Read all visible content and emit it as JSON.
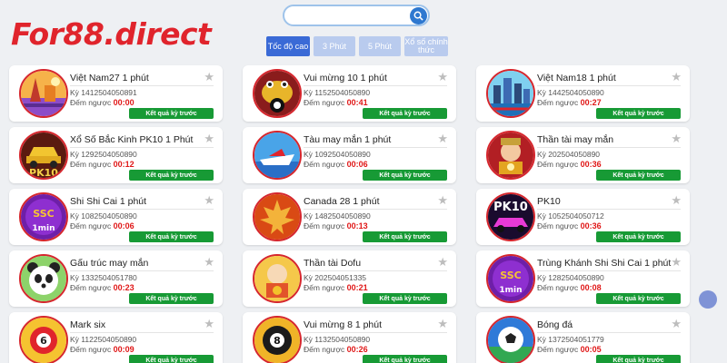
{
  "brand": {
    "logo": "For88.direct"
  },
  "search": {
    "placeholder": ""
  },
  "tabs": [
    {
      "label": "Tốc độ cao",
      "active": true
    },
    {
      "label": "3 Phút",
      "active": false
    },
    {
      "label": "5 Phút",
      "active": false
    },
    {
      "label": "Xổ số chính thức",
      "active": false
    }
  ],
  "labels": {
    "period_prefix": "Kỳ",
    "countdown_prefix": "Đếm ngược",
    "result_button": "Kết quả kỳ trước"
  },
  "games": [
    {
      "title": "Việt Nam27 1 phút",
      "period": "1412504050891",
      "countdown": "00:00",
      "icon": "vietnam-landmark-icon"
    },
    {
      "title": "Vui mừng 10 1 phút",
      "period": "1152504050890",
      "countdown": "00:41",
      "icon": "golden-frog-ball-icon"
    },
    {
      "title": "Việt Nam18 1 phút",
      "period": "1442504050890",
      "countdown": "00:27",
      "icon": "vietnam-city-icon"
    },
    {
      "title": "Xổ Số Bắc Kinh PK10 1 Phút",
      "period": "1292504050890",
      "countdown": "00:12",
      "icon": "pk10-car-icon"
    },
    {
      "title": "Tàu may mắn 1 phút",
      "period": "1092504050890",
      "countdown": "00:06",
      "icon": "speedboat-icon"
    },
    {
      "title": "Thần tài may mắn",
      "period": "202504050890",
      "countdown": "00:36",
      "icon": "wealth-god-icon"
    },
    {
      "title": "Shi Shi Cai 1 phút",
      "period": "1082504050890",
      "countdown": "00:06",
      "icon": "shishicai-1min-icon"
    },
    {
      "title": "Canada 28 1 phút",
      "period": "1482504050890",
      "countdown": "00:13",
      "icon": "maple-leaf-icon"
    },
    {
      "title": "PK10",
      "period": "1052504050712",
      "countdown": "00:36",
      "icon": "pk10-pink-car-icon"
    },
    {
      "title": "Gấu trúc may mắn",
      "period": "1332504051780",
      "countdown": "00:23",
      "icon": "panda-icon"
    },
    {
      "title": "Thần tài Dofu",
      "period": "202504051335",
      "countdown": "00:21",
      "icon": "dofu-god-icon"
    },
    {
      "title": "Trùng Khánh Shi Shi Cai 1 phút",
      "period": "1282504050890",
      "countdown": "00:08",
      "icon": "shishicai-1min-icon"
    },
    {
      "title": "Mark six",
      "period": "1122504050890",
      "countdown": "00:09",
      "icon": "lottery-ball-6-icon"
    },
    {
      "title": "Vui mừng 8 1 phút",
      "period": "1132504050890",
      "countdown": "00:26",
      "icon": "ball-8-icon"
    },
    {
      "title": "Bóng đá",
      "period": "1372504051779",
      "countdown": "00:05",
      "icon": "soccer-ball-icon"
    }
  ],
  "colors": {
    "brand_red": "#e0242c",
    "tab_active": "#3a6ad6",
    "tab_inactive": "#b9cbee",
    "result_green": "#179a35",
    "countdown_red": "#e01818"
  }
}
